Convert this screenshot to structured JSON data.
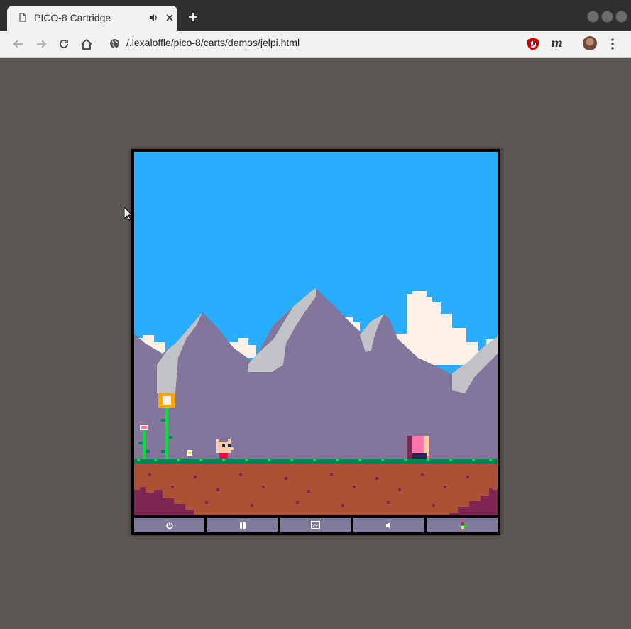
{
  "browser": {
    "tab_title": "PICO-8 Cartridge",
    "url": "/.lexaloffle/pico-8/carts/demos/jelpi.html",
    "icons": [
      "document-icon",
      "speaker-icon",
      "close-icon",
      "new-tab-icon",
      "back-icon",
      "forward-icon",
      "reload-icon",
      "home-icon",
      "site-info-icon",
      "ublock-icon",
      "extension-m-icon",
      "avatar",
      "menu-icon"
    ],
    "extension_m_label": "m"
  },
  "cartridge": {
    "game": "jelpi",
    "colors": {
      "sky": "#29adff",
      "mountain": "#83769c",
      "snow": "#c2c3c7",
      "cloud": "#fff1e8",
      "grass": "#008751",
      "grass_light": "#00e436",
      "dirt": "#ab5236",
      "dirt_dark": "#7e2553"
    },
    "controls": [
      {
        "name": "power-icon"
      },
      {
        "name": "pause-icon"
      },
      {
        "name": "fullscreen-icon"
      },
      {
        "name": "sound-icon"
      },
      {
        "name": "gamepad-icon"
      }
    ]
  }
}
